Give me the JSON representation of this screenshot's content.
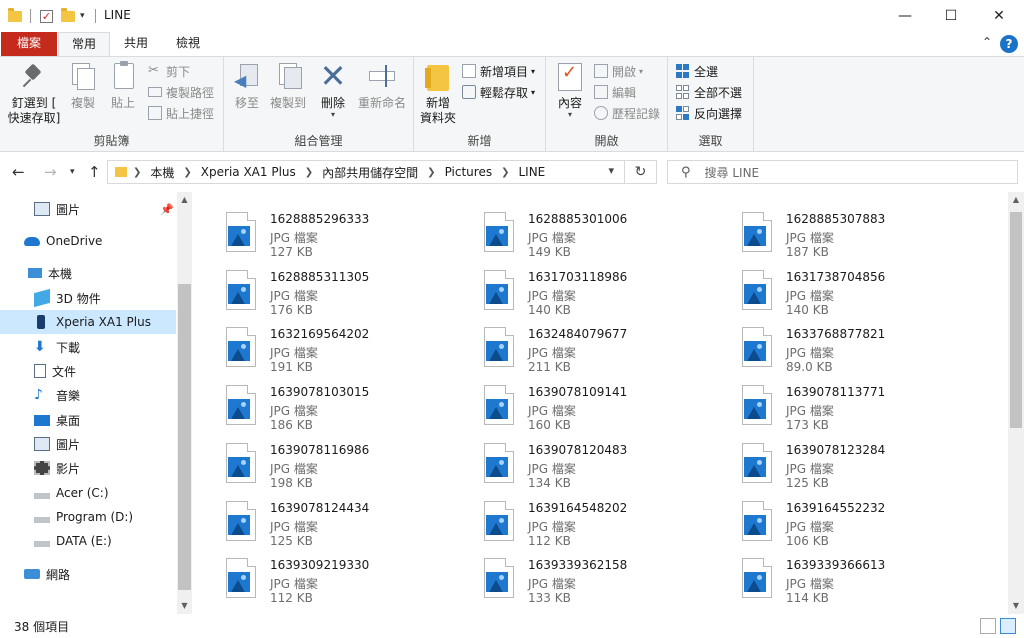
{
  "window": {
    "title": "LINE",
    "minimize_glyph": "—",
    "maximize_glyph": "☐",
    "close_glyph": "✕",
    "quick_access_arrow": "▾"
  },
  "ribbon_tabs": {
    "file": "檔案",
    "home": "常用",
    "share": "共用",
    "view": "檢視",
    "collapse_glyph": "⌃",
    "help_glyph": "?"
  },
  "ribbon": {
    "clipboard": {
      "label": "剪貼簿",
      "pin_line1": "釘選到 [",
      "pin_line2": "快速存取]",
      "copy": "複製",
      "paste": "貼上",
      "cut": "剪下",
      "copy_path": "複製路徑",
      "paste_shortcut": "貼上捷徑"
    },
    "organize": {
      "label": "組合管理",
      "move_to": "移至",
      "copy_to": "複製到",
      "delete": "刪除",
      "rename": "重新命名"
    },
    "new": {
      "label": "新增",
      "new_folder_line1": "新增",
      "new_folder_line2": "資料夾",
      "new_item": "新增項目",
      "easy_access": "輕鬆存取"
    },
    "open": {
      "label": "開啟",
      "properties": "內容",
      "open": "開啟",
      "edit": "編輯",
      "history": "歷程記錄"
    },
    "select": {
      "label": "選取",
      "select_all": "全選",
      "select_none": "全部不選",
      "invert": "反向選擇"
    }
  },
  "address": {
    "crumbs": [
      "本機",
      "Xperia XA1 Plus",
      "內部共用儲存空間",
      "Pictures",
      "LINE"
    ],
    "search_placeholder": "搜尋 LINE"
  },
  "nav_pane": {
    "items": [
      {
        "label": "圖片",
        "icon": "pictures-icon"
      },
      {
        "label": "OneDrive",
        "icon": "onedrive-icon"
      },
      {
        "label": "本機",
        "icon": "this-pc-icon"
      },
      {
        "label": "3D 物件",
        "icon": "3d-objects-icon"
      },
      {
        "label": "Xperia XA1 Plus",
        "icon": "phone-icon"
      },
      {
        "label": "下載",
        "icon": "download-icon"
      },
      {
        "label": "文件",
        "icon": "documents-icon"
      },
      {
        "label": "音樂",
        "icon": "music-icon"
      },
      {
        "label": "桌面",
        "icon": "desktop-icon"
      },
      {
        "label": "圖片",
        "icon": "pictures-icon"
      },
      {
        "label": "影片",
        "icon": "videos-icon"
      },
      {
        "label": "Acer (C:)",
        "icon": "drive-icon"
      },
      {
        "label": "Program (D:)",
        "icon": "drive-icon"
      },
      {
        "label": "DATA (E:)",
        "icon": "drive-icon"
      },
      {
        "label": "網路",
        "icon": "network-icon"
      }
    ]
  },
  "files": [
    {
      "name": "1628885296333",
      "type": "JPG 檔案",
      "size": "127 KB"
    },
    {
      "name": "1628885301006",
      "type": "JPG 檔案",
      "size": "149 KB"
    },
    {
      "name": "1628885307883",
      "type": "JPG 檔案",
      "size": "187 KB"
    },
    {
      "name": "1628885311305",
      "type": "JPG 檔案",
      "size": "176 KB"
    },
    {
      "name": "1631703118986",
      "type": "JPG 檔案",
      "size": "140 KB"
    },
    {
      "name": "1631738704856",
      "type": "JPG 檔案",
      "size": "140 KB"
    },
    {
      "name": "1632169564202",
      "type": "JPG 檔案",
      "size": "191 KB"
    },
    {
      "name": "1632484079677",
      "type": "JPG 檔案",
      "size": "211 KB"
    },
    {
      "name": "1633768877821",
      "type": "JPG 檔案",
      "size": "89.0 KB"
    },
    {
      "name": "1639078103015",
      "type": "JPG 檔案",
      "size": "186 KB"
    },
    {
      "name": "1639078109141",
      "type": "JPG 檔案",
      "size": "160 KB"
    },
    {
      "name": "1639078113771",
      "type": "JPG 檔案",
      "size": "173 KB"
    },
    {
      "name": "1639078116986",
      "type": "JPG 檔案",
      "size": "198 KB"
    },
    {
      "name": "1639078120483",
      "type": "JPG 檔案",
      "size": "134 KB"
    },
    {
      "name": "1639078123284",
      "type": "JPG 檔案",
      "size": "125 KB"
    },
    {
      "name": "1639078124434",
      "type": "JPG 檔案",
      "size": "125 KB"
    },
    {
      "name": "1639164548202",
      "type": "JPG 檔案",
      "size": "112 KB"
    },
    {
      "name": "1639164552232",
      "type": "JPG 檔案",
      "size": "106 KB"
    },
    {
      "name": "1639309219330",
      "type": "JPG 檔案",
      "size": "112 KB"
    },
    {
      "name": "1639339362158",
      "type": "JPG 檔案",
      "size": "133 KB"
    },
    {
      "name": "1639339366613",
      "type": "JPG 檔案",
      "size": "114 KB"
    }
  ],
  "status": {
    "item_count": "38 個項目"
  },
  "colors": {
    "file_tab": "#c42b1c",
    "selection": "#cce8ff",
    "accent_blue": "#1e78d0"
  }
}
